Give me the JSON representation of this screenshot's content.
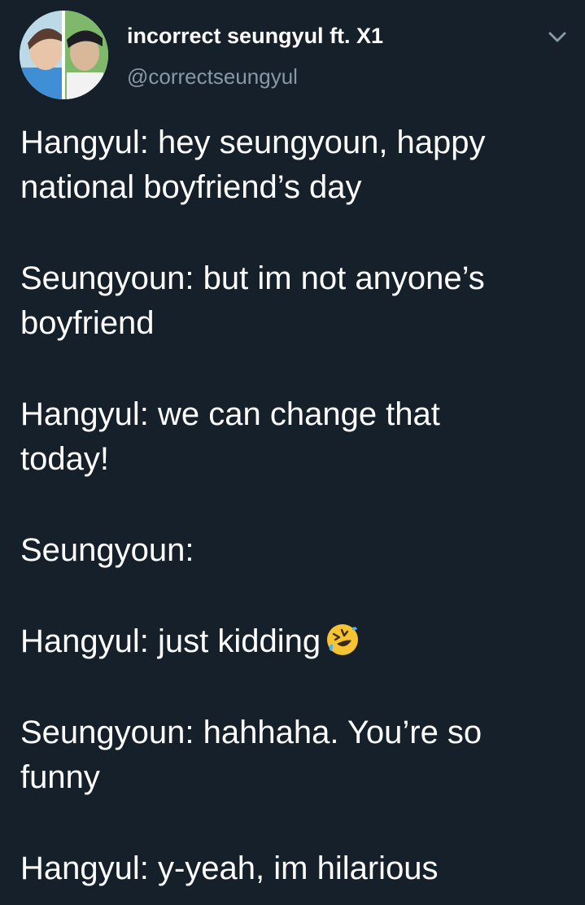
{
  "header": {
    "display_name": "incorrect seungyul ft. X1",
    "handle": "@correctseungyul",
    "avatar_icon": "profile-photo",
    "menu_icon": "chevron-down-icon"
  },
  "tweet": {
    "paragraphs": [
      {
        "lines": [
          "Hangyul: hey seungyoun, happy",
          "national boyfriend’s day"
        ]
      },
      {
        "lines": [
          "Seungyoun: but im not anyone’s",
          "boyfriend"
        ]
      },
      {
        "lines": [
          "Hangyul: we can change that",
          "today!"
        ]
      },
      {
        "lines": [
          "Seungyoun:"
        ]
      },
      {
        "lines": [
          "Hangyul: just kidding"
        ],
        "emoji": "rolling-on-floor-laughing"
      },
      {
        "lines": [
          "Seungyoun: hahhaha. You’re so",
          "funny"
        ]
      },
      {
        "lines": [
          "Hangyul: y-yeah, im hilarious"
        ]
      }
    ]
  },
  "colors": {
    "background": "#15202b",
    "text": "#ffffff",
    "secondary_text": "#8899a6"
  }
}
